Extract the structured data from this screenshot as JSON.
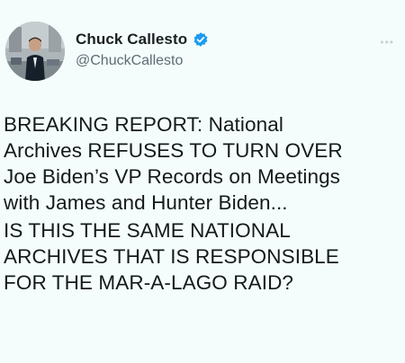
{
  "tweet": {
    "author": {
      "display_name": "Chuck Callesto",
      "handle": "@ChuckCallesto",
      "verified": true,
      "avatar_icon": "profile-photo",
      "verified_color": "#1d9bf0"
    },
    "more_icon": "more-horizontal-icon",
    "paragraphs": [
      {
        "lines": [
          "BREAKING REPORT: National",
          "Archives REFUSES TO TURN OVER",
          "Joe Biden’s VP Records on Meetings",
          "with James and Hunter Biden..."
        ]
      },
      {
        "lines": [
          "IS THIS THE SAME NATIONAL",
          "ARCHIVES THAT IS RESPONSIBLE",
          "FOR THE MAR-A-LAGO RAID?"
        ]
      }
    ]
  }
}
